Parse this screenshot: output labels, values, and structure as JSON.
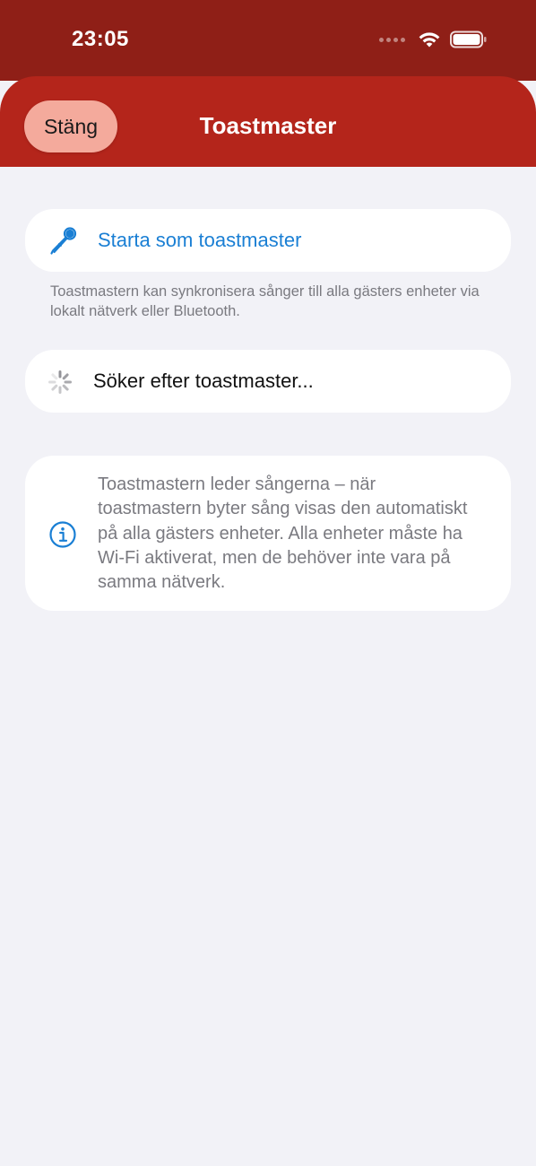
{
  "status_bar": {
    "time": "23:05"
  },
  "header": {
    "close_label": "Stäng",
    "title": "Toastmaster"
  },
  "start_row": {
    "icon": "microphone-icon",
    "label": "Starta som toastmaster"
  },
  "start_footnote": "Toastmastern kan synkronisera sånger till alla gästers enheter via lokalt nätverk eller Bluetooth.",
  "search_row": {
    "icon": "spinner-icon",
    "label": "Söker efter toastmaster..."
  },
  "info": {
    "icon": "info-icon",
    "text": "Toastmastern leder sångerna – när toastmastern byter sång visas den automatiskt på alla gästers enheter. Alla enheter måste ha Wi-Fi aktiverat, men de behöver inte vara på samma nätverk."
  },
  "colors": {
    "status_bar_bg": "#8f1f17",
    "header_bg": "#b4251b",
    "close_button_bg": "#f4aa9c",
    "accent_blue": "#1a7fd4",
    "background": "#f2f2f7",
    "secondary_text": "#7a7a80"
  }
}
